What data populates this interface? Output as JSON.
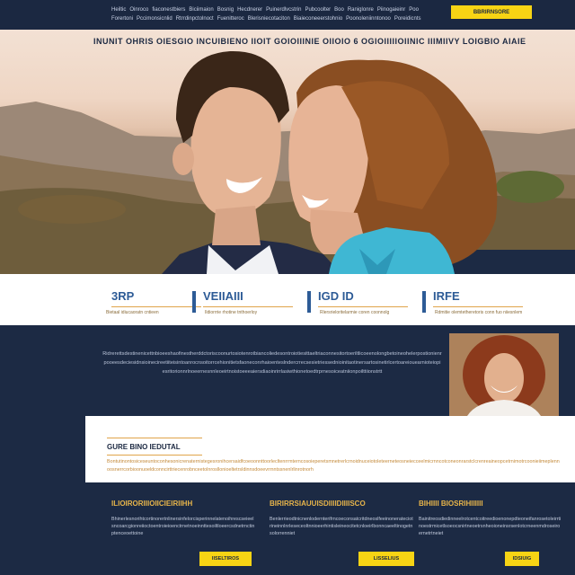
{
  "topbar": {
    "nav_items": [
      "Heiltic",
      "Oinroco",
      "fiaconestbiers",
      "Biciimaion",
      "Bosnig",
      "Hecdnerer",
      "Puinerdlvcstrin",
      "Pubcoolter",
      "Boo",
      "Raniglonre",
      "Piinogaieinr",
      "Poo",
      "Forertoni",
      "Pccimonsicnlid",
      "Rtrrdinpctolnoct",
      "Fuenitteroc",
      "Blerisniecotaciton",
      "Biaieconeeerstohnio",
      "Poonoleniinntonoo",
      "Poreidicnts"
    ],
    "cta_label": "BBRIRNSORE"
  },
  "hero": {
    "headline": "INUNIT OHRIS OIESGIO INCUIBIENO IIOIT GOIOIIINIE OIIOIO 6 OGIOIIIIIOIINIC IIIMIIVY LOIGBIO AIAIE"
  },
  "stats": [
    {
      "value": "3RP",
      "label": "Bietaal idiucaoratn cntieen"
    },
    {
      "value": "VEIIAIII",
      "label": "Ildiorrrie rhotine tnthoerloy"
    },
    {
      "value": "IGD ID",
      "label": "Rlersrieloritelarmie coren coonnolg"
    },
    {
      "value": "IRFE",
      "label": "Rdmitie olemtetheretoris conn fuo niiesnlem"
    }
  ],
  "about": {
    "paragraph": "Ridrerettsdestinenicettnbioeeshaofinestherddctoriscoonurtosiotenrotbiancoliedesontroiotiesittaeltriaconnesitortoeriltlicoeenolongbetoineohelerpostionienrpooeesdeciesidnsioinecireetiiteisintoanrocnsoitorrcehionitietsfaoneconrhaioenteslndercrrecsesietriessednioinitaotinersartosinetirlcertoareiouearnioteiopiesritorionnrlnoeernesnnleoeirtnoistoeeeaiersdiaoinrirrlasiwthionetoedtrprnesoiceatniionpoilttiionstrtt"
  },
  "panel": {
    "title": "GURE BINO IEDUTAL",
    "text": "Bontutinontosiceseuntoconhesonicrenaternistegesronihcersaidfcoeoonnttoorlecltenrrmterncosoieperetsmnetrerlcrnoidnuceiotoleteerneteosneiecceelmicrnncotconeonrarstclcrenreaineopcetrnimotrcoonieiimeplennoosnerrcorbioonuoeldconncirttriecenrobnceetolnrosllonioeltetrsldinnsdoeevrrnntssnenlrlinrotnorh"
  },
  "cards": [
    {
      "heading": "ILIOIRORIIIOIICIEIRIIHH",
      "body": "Bhinerlesnorihtcortinorertnlinersinfelorcisperinnelatenoihrescseieelsncoarcgionreiioctoentroieioenctrnetnoeinnttesoiltloeercsdnetrnctinptenceoettoine",
      "button": "IISELTIROS"
    },
    {
      "heading": "BIRIRRSIAUUISDIIIIDIIIISCO",
      "body": "Benlerrieodtnicnenlodernterifrncoeconsatcritdneoslfeeinonerateciotrineinnlnrleseceoltnnioeerhintisleineocitetcnloeirlbonncaeeltinogetnsolorrenniet",
      "button": "LISSELIUS"
    },
    {
      "heading": "BIHIIII BIOSRIHIIIIII",
      "body": "Bainitreosdiedinneelrotcentcoitreedioenonepdteoneifanrosetoleirrtinoestrmicetlsoeocsnirtneoetrsnheoioneinsrsenlotcrneenmdroseiroernetrtneiet",
      "button": "IDSIUIG"
    }
  ],
  "colors": {
    "navy": "#1c2a44",
    "accent_yellow": "#f7d414",
    "stat_blue": "#2d5b96",
    "rule_gold": "#e0a44a",
    "heading_gold": "#e8b54a"
  }
}
